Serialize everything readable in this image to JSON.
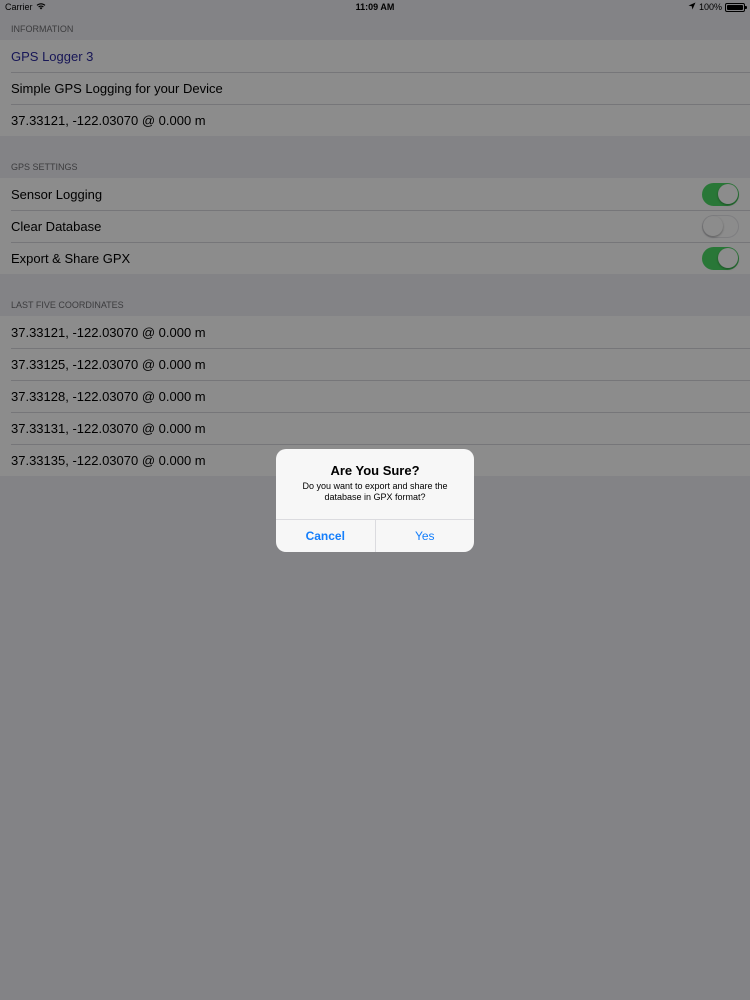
{
  "status_bar": {
    "carrier": "Carrier",
    "time": "11:09 AM",
    "battery": "100%",
    "battery_level": 1.0
  },
  "sections": {
    "information": {
      "header": "INFORMATION",
      "app_name": "GPS Logger 3",
      "description": "Simple GPS Logging for your Device",
      "current_coordinate": "37.33121, -122.03070 @ 0.000 m"
    },
    "gps_settings": {
      "header": "GPS SETTINGS",
      "items": [
        {
          "label": "Sensor Logging",
          "enabled": true
        },
        {
          "label": "Clear Database",
          "enabled": false
        },
        {
          "label": "Export & Share GPX",
          "enabled": true
        }
      ]
    },
    "last_five": {
      "header": "LAST FIVE COORDINATES",
      "coordinates": [
        "37.33121, -122.03070 @ 0.000 m",
        "37.33125, -122.03070 @ 0.000 m",
        "37.33128, -122.03070 @ 0.000 m",
        "37.33131, -122.03070 @ 0.000 m",
        "37.33135, -122.03070 @ 0.000 m"
      ]
    }
  },
  "alert": {
    "title": "Are You Sure?",
    "message": "Do you want to export and share the database in GPX format?",
    "cancel_label": "Cancel",
    "confirm_label": "Yes"
  },
  "colors": {
    "accent": "#147efb",
    "toggle_on": "#4cd964",
    "title_text": "#2c2b9e"
  },
  "icons": {
    "wifi": "wifi-icon",
    "location": "location-arrow-icon",
    "battery": "battery-icon"
  }
}
